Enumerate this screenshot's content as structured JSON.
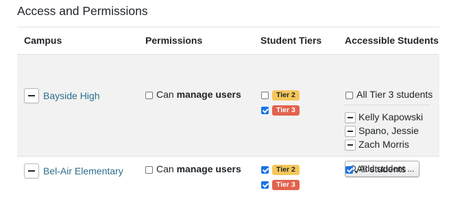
{
  "title": "Access and Permissions",
  "columns": [
    "Campus",
    "Permissions",
    "Student Tiers",
    "Accessible Students"
  ],
  "rows": [
    {
      "campus": "Bayside High",
      "permission_prefix": "Can ",
      "permission_bold": "manage users",
      "permission_checked": false,
      "tiers": [
        {
          "label": "Tier 2",
          "checked": false,
          "color": "#f5c65a"
        },
        {
          "label": "Tier 3",
          "checked": true,
          "color": "#e2634d"
        }
      ],
      "all_students_label": "All Tier 3 students",
      "all_students_checked": false,
      "students": [
        "Kelly Kapowski",
        "Spano, Jessie",
        "Zach Morris"
      ],
      "add_student_label": "Add student ..."
    },
    {
      "campus": "Bel-Air Elementary",
      "permission_prefix": "Can ",
      "permission_bold": "manage users",
      "permission_checked": false,
      "tiers": [
        {
          "label": "Tier 2",
          "checked": true,
          "color": "#f5c65a"
        },
        {
          "label": "Tier 3",
          "checked": true,
          "color": "#e2634d"
        }
      ],
      "all_students_label": "All students",
      "all_students_checked": true
    }
  ],
  "icons": {
    "remove": "minus-icon",
    "search": "search-icon"
  },
  "colors": {
    "link": "#2c6e8a",
    "checkbox_checked": "#1a73e8",
    "row_highlight": "#f2f2f2"
  }
}
